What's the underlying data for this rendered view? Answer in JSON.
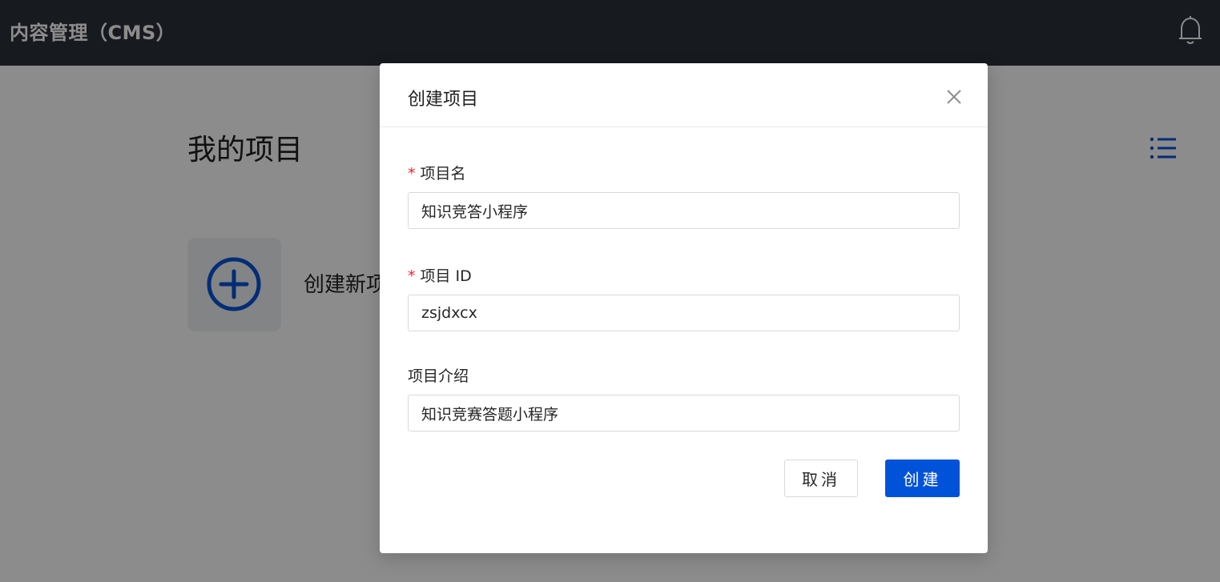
{
  "header": {
    "title": "内容管理（CMS）",
    "bell_icon": "bell-icon"
  },
  "main": {
    "page_title": "我的项目",
    "view_toggle_icon": "list-icon",
    "new_project_label": "创建新项",
    "new_project_icon": "plus-circle-icon"
  },
  "modal": {
    "title": "创建项目",
    "close_icon": "close-icon",
    "fields": [
      {
        "label": "项目名",
        "required": true,
        "value": "知识竞答小程序"
      },
      {
        "label": "项目 ID",
        "required": true,
        "value": "zsjdxcx"
      },
      {
        "label": "项目介绍",
        "required": false,
        "value": "知识竞赛答题小程序"
      }
    ],
    "required_mark": "*",
    "cancel_label": "取消",
    "create_label": "创建"
  },
  "colors": {
    "header_bg": "#2b313a",
    "primary": "#0052d9",
    "required": "#f5222d",
    "overlay": "rgba(0,0,0,0.45)"
  }
}
